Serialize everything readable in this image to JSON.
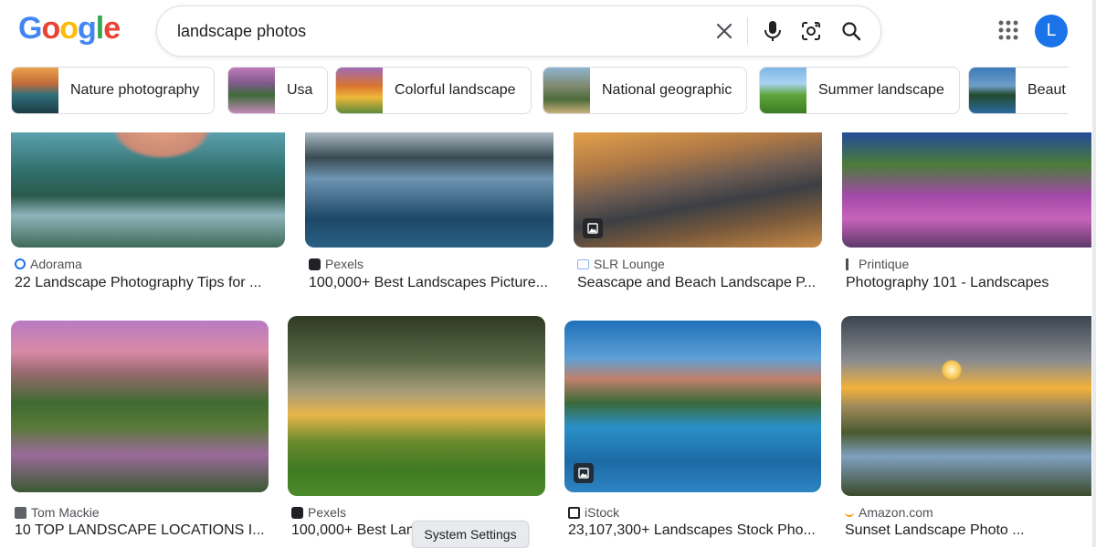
{
  "logo": {
    "letters": [
      "G",
      "o",
      "o",
      "g",
      "l",
      "e"
    ],
    "colors": [
      "#4285F4",
      "#EA4335",
      "#FBBC05",
      "#4285F4",
      "#34A853",
      "#EA4335"
    ]
  },
  "search": {
    "value": "landscape photos",
    "clear_icon": "close-icon",
    "voice_icon": "mic-icon",
    "lens_icon": "camera-lens-icon",
    "search_icon": "search-icon"
  },
  "header": {
    "apps_icon": "apps-grid-icon",
    "avatar_letter": "L",
    "avatar_color": "#1a73e8"
  },
  "chips": [
    {
      "label": "Nature photography"
    },
    {
      "label": "Usa"
    },
    {
      "label": "Colorful landscape"
    },
    {
      "label": "National geographic"
    },
    {
      "label": "Summer landscape"
    },
    {
      "label": "Beaut"
    }
  ],
  "results": [
    {
      "source": "Adorama",
      "title": "22 Landscape Photography Tips for ..."
    },
    {
      "source": "Pexels",
      "title": "100,000+ Best Landscapes Picture..."
    },
    {
      "source": "SLR Lounge",
      "title": "Seascape and Beach Landscape P..."
    },
    {
      "source": "Printique",
      "title": "Photography 101 - Landscapes"
    },
    {
      "source": "Tom Mackie",
      "title": "10 TOP LANDSCAPE LOCATIONS I..."
    },
    {
      "source": "Pexels",
      "title": "100,000+ Best Lan"
    },
    {
      "source": "iStock",
      "title": "23,107,300+ Landscapes Stock Pho..."
    },
    {
      "source": "Amazon.com",
      "title": "Sunset Landscape Photo ..."
    }
  ],
  "tooltip": "System Settings"
}
